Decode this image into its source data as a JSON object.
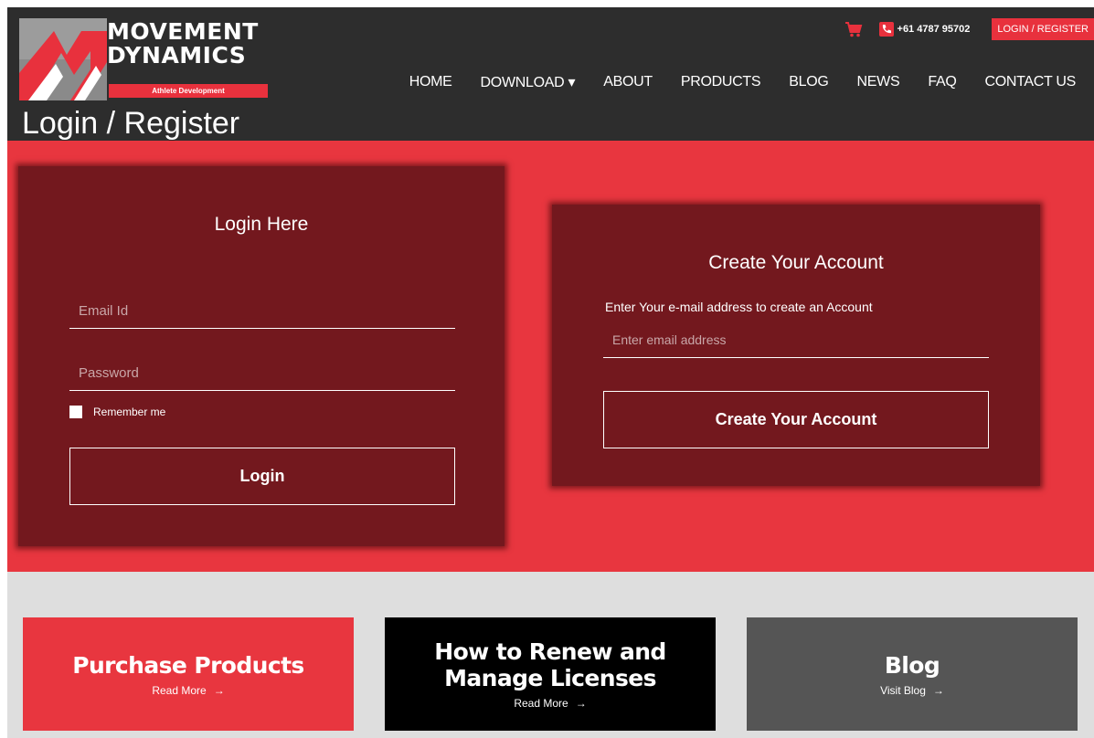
{
  "brand": {
    "name_line1": "MOVEMENT",
    "name_line2": "DYNAMICS",
    "tagline": "Athlete Development",
    "accent": "#e8313d",
    "header_bg": "#2d2d2d"
  },
  "topbar": {
    "cart_icon": "cart-icon",
    "phone_icon": "phone-icon",
    "phone": "+61 4787 95702",
    "login_register": "LOGIN / REGISTER"
  },
  "nav": {
    "items": [
      {
        "label": "HOME"
      },
      {
        "label": "DOWNLOAD ▾"
      },
      {
        "label": "ABOUT"
      },
      {
        "label": "PRODUCTS"
      },
      {
        "label": "BLOG"
      },
      {
        "label": "NEWS"
      },
      {
        "label": "FAQ"
      },
      {
        "label": "CONTACT US"
      }
    ]
  },
  "page": {
    "title": "Login / Register"
  },
  "login": {
    "title": "Login Here",
    "email_placeholder": "Email Id",
    "password_placeholder": "Password",
    "remember_label": "Remember me",
    "button": "Login"
  },
  "create": {
    "title": "Create Your Account",
    "description": "Enter Your e-mail address to create an Account",
    "email_placeholder": "Enter email address",
    "button": "Create Your Account"
  },
  "cards": [
    {
      "title_line1": "Purchase Products",
      "title_line2": "",
      "link": "Read More",
      "color": "#e8363f"
    },
    {
      "title_line1": "How to Renew and",
      "title_line2": "Manage Licenses",
      "link": "Read More",
      "color": "#000000"
    },
    {
      "title_line1": "Blog",
      "title_line2": "",
      "link": "Visit Blog",
      "color": "#555555"
    }
  ],
  "arrow": "→"
}
